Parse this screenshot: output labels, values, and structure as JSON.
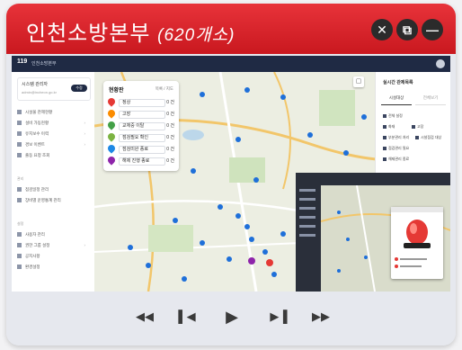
{
  "window": {
    "title": "인천소방본부",
    "title_count": "(620개소)"
  },
  "titlebar_buttons": [
    {
      "name": "close-button",
      "glyph": "✕"
    },
    {
      "name": "copy-button",
      "glyph": "⧉"
    },
    {
      "name": "minimize-button",
      "glyph": "—"
    }
  ],
  "app": {
    "header_logo": "119",
    "header_brand": "인천소방본부",
    "user": {
      "name": "시스템 관리자",
      "email": "admin@incheon.go.kr",
      "badge": "수정"
    },
    "sidebar_sections": [
      "관리",
      "설정"
    ],
    "sidebar_items": [
      "시설물 관제현황",
      "설비 가동현황",
      "유지보수 이력",
      "경보 이벤트",
      "출동 요청 조회",
      "점검일정 관리",
      "장비별 운영통계 관리",
      "사용자 관리",
      "권한 그룹 설정",
      "공지사항",
      "환경설정"
    ]
  },
  "status_panel": {
    "title": "현황판",
    "mode": "목록 / 지도",
    "rows": [
      {
        "label": "정상",
        "value": "0 건",
        "color": "#e53935"
      },
      {
        "label": "고장",
        "value": "0 건",
        "color": "#fb8c00"
      },
      {
        "label": "교체중 이탈",
        "value": "0 건",
        "color": "#43a047"
      },
      {
        "label": "점검필요 확인",
        "value": "0 건",
        "color": "#7cb342"
      },
      {
        "label": "점검미완 종료",
        "value": "0 건",
        "color": "#1e88e5"
      },
      {
        "label": "해제 진행 종료",
        "value": "0 건",
        "color": "#8e24aa"
      }
    ]
  },
  "right_panel": {
    "title": "실시간 관제목록",
    "tabs": [
      "시설대상",
      "전체보기"
    ],
    "items": [
      "전체 설정",
      "화재",
      "고장",
      "부분관리 처리",
      "시설점검 대상",
      "점검관리 필요",
      "해제관리 종료"
    ]
  },
  "player": {
    "controls": [
      {
        "name": "rewind-button",
        "glyph": "◀◀"
      },
      {
        "name": "prev-button",
        "glyph": "▌◀"
      },
      {
        "name": "play-button",
        "glyph": "▶"
      },
      {
        "name": "next-button",
        "glyph": "▶▐"
      },
      {
        "name": "fast-forward-button",
        "glyph": "▶▶"
      }
    ]
  },
  "colors": {
    "titlebar": "#d4222a",
    "header": "#1f2a44",
    "map_pin_blue": "#1e6fd9"
  }
}
